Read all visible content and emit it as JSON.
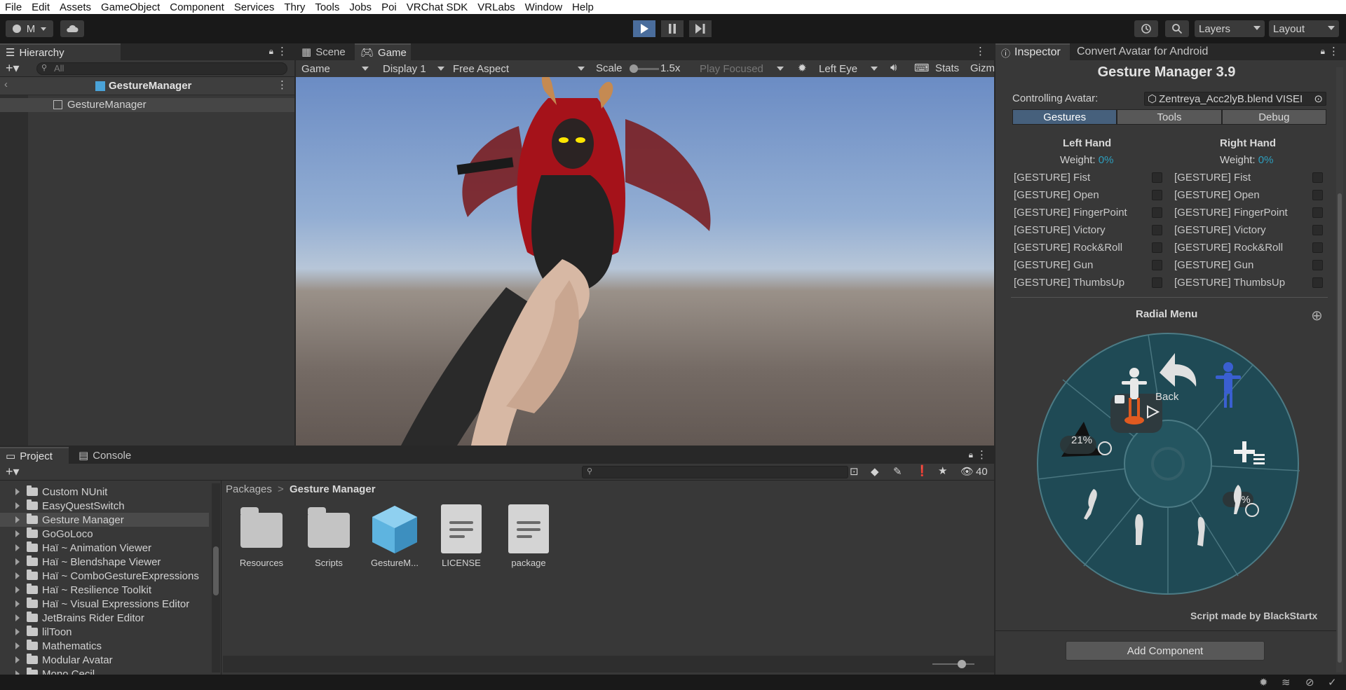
{
  "menu": [
    "File",
    "Edit",
    "Assets",
    "GameObject",
    "Component",
    "Services",
    "Thry",
    "Tools",
    "Jobs",
    "Poi",
    "VRChat SDK",
    "VRLabs",
    "Window",
    "Help"
  ],
  "toolbar": {
    "account_label": "M",
    "layers_label": "Layers",
    "layout_label": "Layout"
  },
  "hierarchy": {
    "tab": "Hierarchy",
    "search_placeholder": "All",
    "scene_title": "GestureManager",
    "items": [
      "GestureManager"
    ]
  },
  "game_view": {
    "tabs": [
      "Scene",
      "Game"
    ],
    "mode": "Game",
    "display": "Display 1",
    "aspect": "Free Aspect",
    "scale_label": "Scale",
    "scale_value": "1.5x",
    "play_focus": "Play Focused",
    "eye": "Left Eye",
    "stats": "Stats",
    "gizmos": "Gizm"
  },
  "project": {
    "tabs": [
      "Project",
      "Console"
    ],
    "hidden_count": "40",
    "breadcrumb": [
      "Packages",
      "Gesture Manager"
    ],
    "tree": [
      {
        "label": "Custom NUnit",
        "selected": false
      },
      {
        "label": "EasyQuestSwitch",
        "selected": false
      },
      {
        "label": "Gesture Manager",
        "selected": true
      },
      {
        "label": "GoGoLoco",
        "selected": false
      },
      {
        "label": "Haï ~ Animation Viewer",
        "selected": false
      },
      {
        "label": "Haï ~ Blendshape Viewer",
        "selected": false
      },
      {
        "label": "Haï ~ ComboGestureExpressions",
        "selected": false
      },
      {
        "label": "Haï ~ Resilience Toolkit",
        "selected": false
      },
      {
        "label": "Haï ~ Visual Expressions Editor",
        "selected": false
      },
      {
        "label": "JetBrains Rider Editor",
        "selected": false
      },
      {
        "label": "lilToon",
        "selected": false
      },
      {
        "label": "Mathematics",
        "selected": false
      },
      {
        "label": "Modular Avatar",
        "selected": false
      },
      {
        "label": "Mono Cecil",
        "selected": false
      }
    ],
    "assets": [
      {
        "label": "Resources",
        "type": "folder"
      },
      {
        "label": "Scripts",
        "type": "folder"
      },
      {
        "label": "GestureM...",
        "type": "prefab"
      },
      {
        "label": "LICENSE",
        "type": "doc"
      },
      {
        "label": "package",
        "type": "doc"
      }
    ]
  },
  "inspector": {
    "tabs": [
      "Inspector",
      "Convert Avatar for Android"
    ],
    "title": "Gesture Manager 3.9",
    "controlling_label": "Controlling Avatar:",
    "controlling_value": "Zentreya_Acc2lyB.blend VISEI",
    "subtabs": [
      "Gestures",
      "Tools",
      "Debug"
    ],
    "left_hand": "Left Hand",
    "right_hand": "Right Hand",
    "weight_label": "Weight:",
    "left_weight": "0%",
    "right_weight": "0%",
    "gestures": [
      "[GESTURE] Fist",
      "[GESTURE] Open",
      "[GESTURE] FingerPoint",
      "[GESTURE] Victory",
      "[GESTURE] Rock&Roll",
      "[GESTURE] Gun",
      "[GESTURE] ThumbsUp"
    ],
    "radial_title": "Radial Menu",
    "radial_back": "Back",
    "radial_left_value": "21%",
    "radial_right_value": "0%",
    "credit": "Script made by BlackStartx",
    "add_component": "Add Component"
  },
  "colors": {
    "accent": "#4c7dc7",
    "weight": "#2d9fbf",
    "radial_ring": "#1f4a55"
  }
}
